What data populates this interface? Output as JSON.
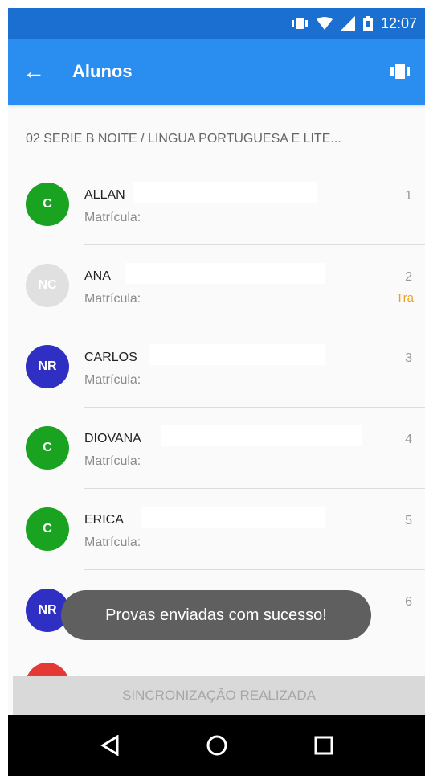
{
  "status_bar": {
    "time": "12:07"
  },
  "app_bar": {
    "title": "Alunos"
  },
  "subtitle": "02 SERIE B  NOITE / LINGUA PORTUGUESA E LITE...",
  "students": [
    {
      "initials": "C",
      "avatar_color": "#1aa320",
      "name": "ALLAN",
      "matricula_label": "Matrícula:",
      "number": "1",
      "badge": ""
    },
    {
      "initials": "NC",
      "avatar_color": "#e0e0e0",
      "name": "ANA",
      "matricula_label": "Matrícula:",
      "number": "2",
      "badge": "Tra"
    },
    {
      "initials": "NR",
      "avatar_color": "#2f2fc4",
      "name": "CARLOS",
      "matricula_label": "Matrícula:",
      "number": "3",
      "badge": ""
    },
    {
      "initials": "C",
      "avatar_color": "#1aa320",
      "name": "DIOVANA",
      "matricula_label": "Matrícula:",
      "number": "4",
      "badge": ""
    },
    {
      "initials": "C",
      "avatar_color": "#1aa320",
      "name": "ERICA",
      "matricula_label": "Matrícula:",
      "number": "5",
      "badge": ""
    },
    {
      "initials": "NR",
      "avatar_color": "#2f2fc4",
      "name": "",
      "matricula_label": "",
      "number": "6",
      "badge": ""
    }
  ],
  "toast": "Provas enviadas com sucesso!",
  "sync_button": "SINCRONIZAÇÃO REALIZADA",
  "nav": {
    "back": "back-icon",
    "home": "home-icon",
    "recents": "recents-icon"
  }
}
